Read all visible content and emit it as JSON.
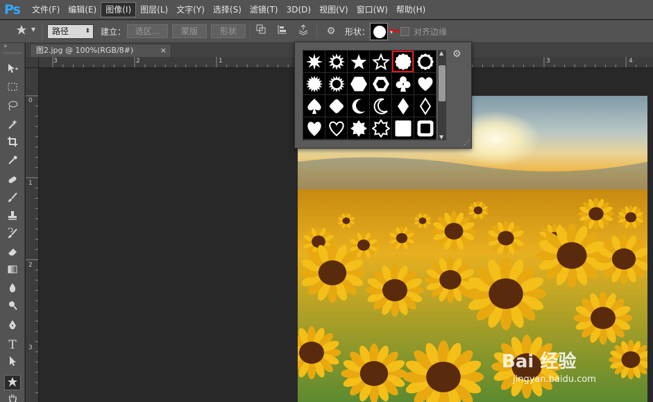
{
  "app": {
    "logo": "Ps"
  },
  "menu": [
    "文件(F)",
    "编辑(E)",
    "图像(I)",
    "图层(L)",
    "文字(Y)",
    "选择(S)",
    "滤镜(T)",
    "3D(D)",
    "视图(V)",
    "窗口(W)",
    "帮助(H)"
  ],
  "menu_active_index": 2,
  "options": {
    "mode_select": "路径",
    "make_label": "建立：",
    "selection_button": "选区...",
    "mask_button": "蒙版",
    "shape_button": "形状",
    "shape_label": "形状：",
    "align_edges_label": "对齐边缘",
    "align_edges_checked": false
  },
  "document": {
    "tab_title": "图2.jpg @ 100%(RGB/8#)",
    "close_glyph": "×"
  },
  "rulers": {
    "horizontal": [
      "3",
      "2",
      "1",
      "3",
      "4"
    ],
    "vertical": [
      "0",
      "1",
      "2",
      "3"
    ]
  },
  "shape_picker": {
    "shapes": [
      "starburst-8",
      "starburst-12",
      "star-5",
      "star-5-outline",
      "seal-filled",
      "seal-outline",
      "sunburst",
      "sunburst-outline",
      "hexagon",
      "hexagon-outline",
      "club",
      "heart",
      "spade",
      "diamond-round",
      "crescent",
      "crescent-outline",
      "diamond",
      "diamond-outline",
      "heart-alt",
      "heart-outline",
      "star-8",
      "star-8-outline",
      "square-round",
      "square-frame"
    ],
    "selected_index": 4
  },
  "toolbar": {
    "tools": [
      "move-tool",
      "marquee-tool",
      "lasso-tool",
      "magic-wand-tool",
      "crop-tool",
      "eyedropper-tool",
      "healing-tool",
      "brush-tool",
      "stamp-tool",
      "history-brush-tool",
      "eraser-tool",
      "gradient-tool",
      "blur-tool",
      "dodge-tool",
      "pen-tool",
      "type-tool",
      "path-select-tool",
      "custom-shape-tool"
    ],
    "selected": "custom-shape-tool"
  },
  "watermark": {
    "logo": "Bai 经验",
    "url": "jingyan.baidu.com"
  },
  "colors": {
    "selection_outline": "#e01818",
    "ps_blue": "#31a8ff"
  }
}
